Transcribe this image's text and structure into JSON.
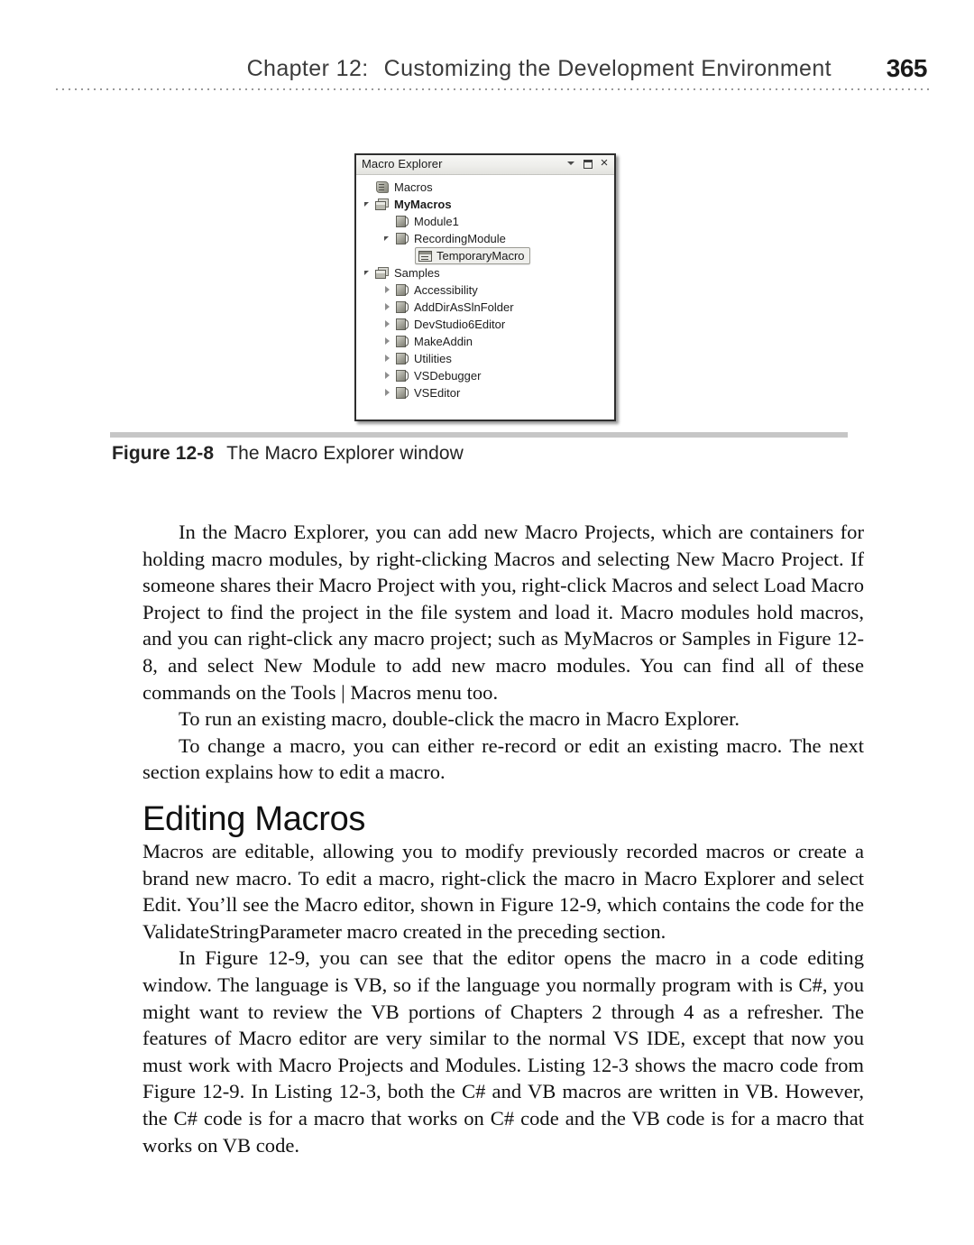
{
  "running_head": {
    "chapter_label": "Chapter 12:",
    "chapter_title": "Customizing the Development Environment",
    "page_number": "365"
  },
  "figure": {
    "window": {
      "title": "Macro Explorer",
      "buttons": [
        {
          "name": "dropdown",
          "glyph": "▾"
        },
        {
          "name": "pin",
          "glyph": "□"
        },
        {
          "name": "close",
          "glyph": "×"
        }
      ],
      "tree": [
        {
          "label": "Macros",
          "icon": "scroll",
          "indent": 0,
          "twisty": "none",
          "bold": false,
          "selected": false
        },
        {
          "label": "MyMacros",
          "icon": "project",
          "indent": 0,
          "twisty": "expanded",
          "bold": true,
          "selected": false
        },
        {
          "label": "Module1",
          "icon": "module",
          "indent": 1,
          "twisty": "none",
          "bold": false,
          "selected": false
        },
        {
          "label": "RecordingModule",
          "icon": "module",
          "indent": 1,
          "twisty": "expanded",
          "bold": false,
          "selected": false
        },
        {
          "label": "TemporaryMacro",
          "icon": "macro",
          "indent": 2,
          "twisty": "none",
          "bold": false,
          "selected": true
        },
        {
          "label": "Samples",
          "icon": "project",
          "indent": 0,
          "twisty": "expanded",
          "bold": false,
          "selected": false
        },
        {
          "label": "Accessibility",
          "icon": "module",
          "indent": 1,
          "twisty": "collapsed",
          "bold": false,
          "selected": false
        },
        {
          "label": "AddDirAsSlnFolder",
          "icon": "module",
          "indent": 1,
          "twisty": "collapsed",
          "bold": false,
          "selected": false
        },
        {
          "label": "DevStudio6Editor",
          "icon": "module",
          "indent": 1,
          "twisty": "collapsed",
          "bold": false,
          "selected": false
        },
        {
          "label": "MakeAddin",
          "icon": "module",
          "indent": 1,
          "twisty": "collapsed",
          "bold": false,
          "selected": false
        },
        {
          "label": "Utilities",
          "icon": "module",
          "indent": 1,
          "twisty": "collapsed",
          "bold": false,
          "selected": false
        },
        {
          "label": "VSDebugger",
          "icon": "module",
          "indent": 1,
          "twisty": "collapsed",
          "bold": false,
          "selected": false
        },
        {
          "label": "VSEditor",
          "icon": "module",
          "indent": 1,
          "twisty": "collapsed",
          "bold": false,
          "selected": false
        }
      ]
    },
    "caption_number": "Figure 12-8",
    "caption_text": "The Macro Explorer window"
  },
  "body": {
    "paragraph1": "In the Macro Explorer, you can add new Macro Projects, which are containers for holding macro modules, by right-clicking Macros and selecting New Macro Project. If someone shares their Macro Project with you, right-click Macros and select Load Macro Project to find the project in the file system and load it. Macro modules hold macros, and you can right-click any macro project; such as MyMacros or Samples in Figure 12-8, and select New Module to add new macro modules. You can find all of these commands on the Tools | Macros menu too.",
    "paragraph2": "To run an existing macro, double-click the macro in Macro Explorer.",
    "paragraph3": "To change a macro, you can either re-record or edit an existing macro. The next section explains how to edit a macro."
  },
  "section": {
    "heading": "Editing Macros",
    "paragraph1": "Macros are editable, allowing you to modify previously recorded macros or create a brand new macro. To edit a macro, right-click the macro in Macro Explorer and select Edit. You’ll see the Macro editor, shown in Figure 12-9, which contains the code for the ValidateStringParameter macro created in the preceding section.",
    "paragraph2": "In Figure 12-9, you can see that the editor opens the macro in a code editing window. The language is VB, so if the language you normally program with is C#, you might want to review the VB portions of Chapters 2 through 4 as a refresher. The features of Macro editor are very similar to the normal VS IDE, except that now you must work with Macro Projects and Modules. Listing 12-3 shows the macro code from Figure 12-9. In Listing 12-3, both the C# and VB macros are written in VB. However, the C# code is for a macro that works on C# code and the VB code is for a macro that works on VB code."
  },
  "colors": {
    "page_background": "#ffffff",
    "text": "#111111",
    "rule": "#c6c6c6",
    "dotted_line": "#9a9a9a",
    "window_border": "#2e2e2e"
  }
}
